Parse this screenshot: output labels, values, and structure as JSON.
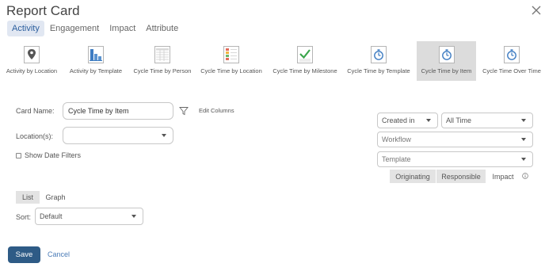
{
  "dialog": {
    "title": "Report Card"
  },
  "tabs": [
    {
      "label": "Activity",
      "active": true
    },
    {
      "label": "Engagement"
    },
    {
      "label": "Impact"
    },
    {
      "label": "Attribute"
    }
  ],
  "report_types": [
    {
      "label": "Activity by Location",
      "icon": "map-pin-icon"
    },
    {
      "label": "Activity by Template",
      "icon": "bar-chart-icon"
    },
    {
      "label": "Cycle Time by Person",
      "icon": "table-grid-icon"
    },
    {
      "label": "Cycle Time by Location",
      "icon": "colored-table-icon"
    },
    {
      "label": "Cycle Time by Milestone",
      "icon": "checkmark-chart-icon"
    },
    {
      "label": "Cycle Time by Template",
      "icon": "stopwatch-icon"
    },
    {
      "label": "Cycle Time by Item",
      "icon": "stopwatch-icon",
      "selected": true
    },
    {
      "label": "Cycle Time Over Time",
      "icon": "stopwatch-icon"
    }
  ],
  "form": {
    "card_name_label": "Card Name:",
    "card_name_value": "Cycle Time by Item",
    "edit_columns": "Edit Columns",
    "locations_label": "Location(s):",
    "locations_value": "",
    "show_date_filters": "Show Date Filters"
  },
  "filters": {
    "created_in": "Created in",
    "time_range": "All Time",
    "workflow_placeholder": "Workflow",
    "template_placeholder": "Template",
    "segments": [
      {
        "label": "Originating",
        "on": true
      },
      {
        "label": "Responsible",
        "on": true
      },
      {
        "label": "Impact",
        "on": false
      }
    ]
  },
  "view": {
    "list": "List",
    "graph": "Graph",
    "sort_label": "Sort:",
    "sort_value": "Default"
  },
  "actions": {
    "save": "Save",
    "cancel": "Cancel"
  },
  "colors": {
    "accent": "#2e5b86",
    "tab_active_bg": "#e1e7f2",
    "link": "#4a7bb7",
    "card_selected_bg": "#dcdcdc"
  }
}
